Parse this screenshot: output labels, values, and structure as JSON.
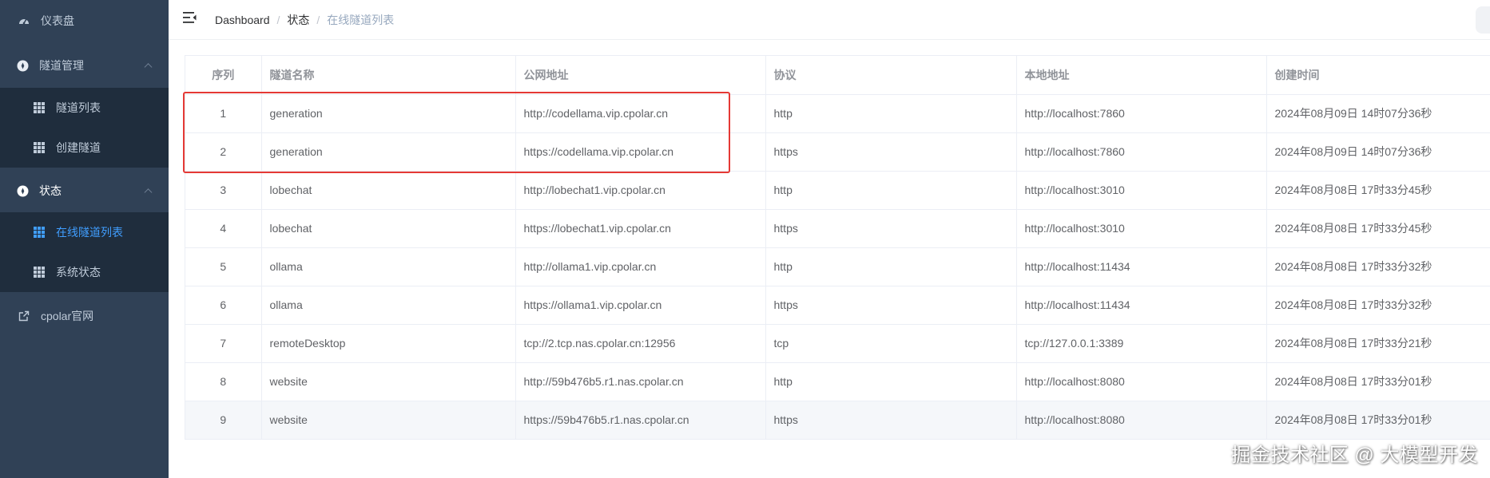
{
  "sidebar": {
    "items": [
      {
        "label": "仪表盘"
      },
      {
        "label": "隧道管理"
      },
      {
        "label": "隧道列表"
      },
      {
        "label": "创建隧道"
      },
      {
        "label": "状态"
      },
      {
        "label": "在线隧道列表"
      },
      {
        "label": "系统状态"
      },
      {
        "label": "cpolar官网"
      }
    ]
  },
  "breadcrumb": [
    "Dashboard",
    "状态",
    "在线隧道列表"
  ],
  "table": {
    "headers": [
      "序列",
      "隧道名称",
      "公网地址",
      "协议",
      "本地地址",
      "创建时间"
    ],
    "rows": [
      [
        "1",
        "generation",
        "http://codellama.vip.cpolar.cn",
        "http",
        "http://localhost:7860",
        "2024年08月09日 14时07分36秒"
      ],
      [
        "2",
        "generation",
        "https://codellama.vip.cpolar.cn",
        "https",
        "http://localhost:7860",
        "2024年08月09日 14时07分36秒"
      ],
      [
        "3",
        "lobechat",
        "http://lobechat1.vip.cpolar.cn",
        "http",
        "http://localhost:3010",
        "2024年08月08日 17时33分45秒"
      ],
      [
        "4",
        "lobechat",
        "https://lobechat1.vip.cpolar.cn",
        "https",
        "http://localhost:3010",
        "2024年08月08日 17时33分45秒"
      ],
      [
        "5",
        "ollama",
        "http://ollama1.vip.cpolar.cn",
        "http",
        "http://localhost:11434",
        "2024年08月08日 17时33分32秒"
      ],
      [
        "6",
        "ollama",
        "https://ollama1.vip.cpolar.cn",
        "https",
        "http://localhost:11434",
        "2024年08月08日 17时33分32秒"
      ],
      [
        "7",
        "remoteDesktop",
        "tcp://2.tcp.nas.cpolar.cn:12956",
        "tcp",
        "tcp://127.0.0.1:3389",
        "2024年08月08日 17时33分21秒"
      ],
      [
        "8",
        "website",
        "http://59b476b5.r1.nas.cpolar.cn",
        "http",
        "http://localhost:8080",
        "2024年08月08日 17时33分01秒"
      ],
      [
        "9",
        "website",
        "https://59b476b5.r1.nas.cpolar.cn",
        "https",
        "http://localhost:8080",
        "2024年08月08日 17时33分01秒"
      ]
    ]
  },
  "watermark": "掘金技术社区 @ 大模型开发",
  "colors": {
    "sidebar_bg": "#304156",
    "submenu_bg": "#1f2d3d",
    "active": "#409eff",
    "highlight_box": "#e53935"
  }
}
